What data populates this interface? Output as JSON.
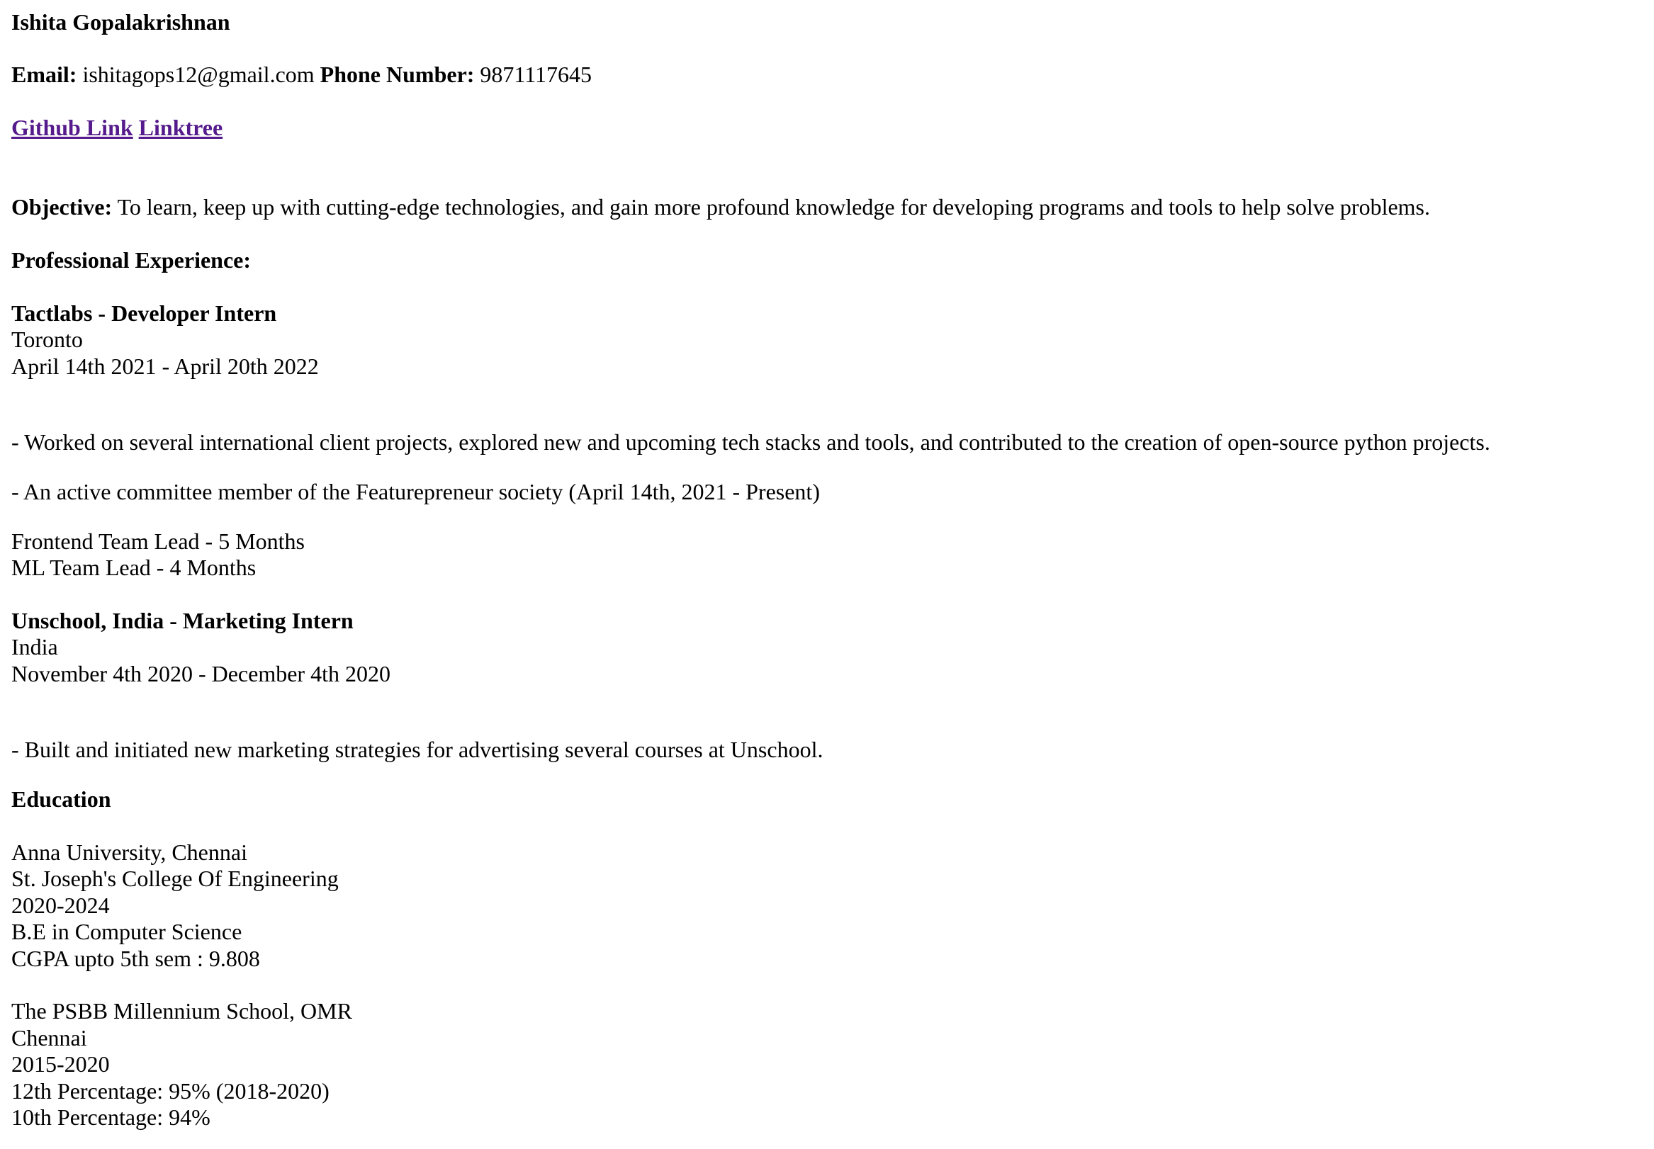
{
  "header": {
    "name": "Ishita Gopalakrishnan",
    "email_label": "Email:",
    "email": "ishitagops12@gmail.com",
    "phone_label": "Phone Number:",
    "phone": "9871117645",
    "links": [
      "Github Link",
      "Linktree"
    ]
  },
  "objective": {
    "label": "Objective:",
    "text": "To learn, keep up with cutting-edge technologies, and gain more profound knowledge for developing programs and tools to help solve problems."
  },
  "experience": {
    "heading": "Professional Experience:",
    "jobs": [
      {
        "title": "Tactlabs - Developer Intern",
        "location": "Toronto",
        "dates": "April 14th 2021 - April 20th 2022",
        "points": [
          "- Worked on several international client projects, explored new and upcoming tech stacks and tools, and contributed to the creation of open-source python projects.",
          "- An active committee member of the Featurepreneur society (April 14th, 2021 - Present)"
        ],
        "roles": [
          "Frontend Team Lead - 5 Months",
          "ML Team Lead - 4 Months"
        ]
      },
      {
        "title": "Unschool, India - Marketing Intern",
        "location": "India",
        "dates": "November 4th 2020 - December 4th 2020",
        "points": [
          "- Built and initiated new marketing strategies for advertising several courses at Unschool."
        ]
      }
    ]
  },
  "education": {
    "heading": "Education",
    "schools": [
      {
        "lines": [
          "Anna University, Chennai",
          "St. Joseph's College Of Engineering",
          "2020-2024",
          "B.E in Computer Science",
          "CGPA upto 5th sem : 9.808"
        ]
      },
      {
        "lines": [
          "The PSBB Millennium School, OMR",
          "Chennai",
          "2015-2020",
          "12th Percentage: 95% (2018-2020)",
          "10th Percentage: 94%"
        ]
      }
    ]
  }
}
